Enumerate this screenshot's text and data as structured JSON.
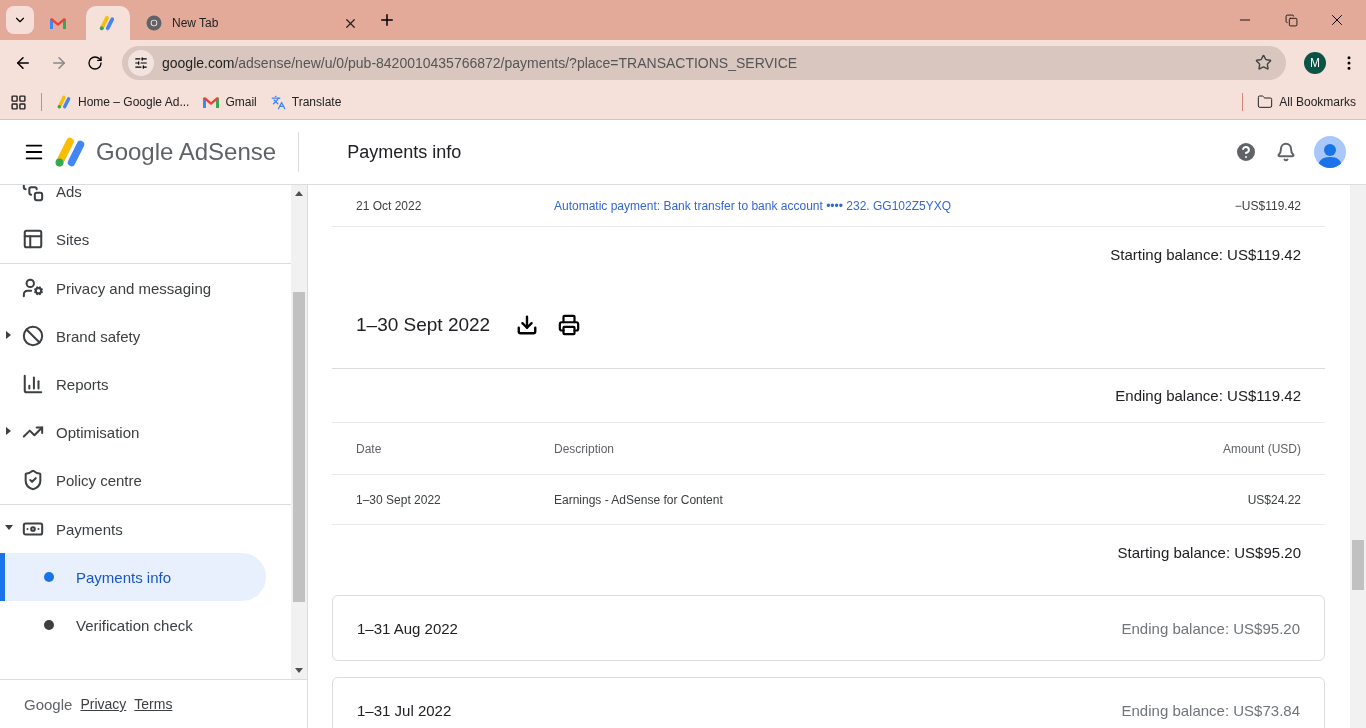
{
  "browser": {
    "tabs": [
      {
        "kind": "gmail",
        "selected": false
      },
      {
        "kind": "adsense",
        "selected": true
      },
      {
        "kind": "chrome",
        "title": "New Tab",
        "selected": false
      }
    ],
    "url_host": "google.com",
    "url_path": "/adsense/new/u/0/pub-8420010435766872/payments/?place=TRANSACTIONS_SERVICE",
    "profile": "M",
    "bookmarks": [
      {
        "kind": "adsense",
        "label": "Home – Google Ad..."
      },
      {
        "kind": "gmail",
        "label": "Gmail"
      },
      {
        "kind": "translate",
        "label": "Translate"
      }
    ],
    "all_bookmarks": "All Bookmarks"
  },
  "header": {
    "logo": "Google AdSense",
    "title": "Payments info"
  },
  "sidebar": {
    "groups": [
      [
        {
          "kind": "ads",
          "label": "Ads"
        },
        {
          "kind": "sites",
          "label": "Sites"
        }
      ],
      [
        {
          "kind": "privacy",
          "label": "Privacy and messaging"
        },
        {
          "kind": "brand",
          "label": "Brand safety",
          "expanded": false
        },
        {
          "kind": "reports",
          "label": "Reports"
        },
        {
          "kind": "optimisation",
          "label": "Optimisation",
          "expanded": false
        },
        {
          "kind": "policy",
          "label": "Policy centre"
        }
      ],
      [
        {
          "kind": "payments",
          "label": "Payments",
          "expanded": true,
          "children": [
            {
              "label": "Payments info",
              "selected": true
            },
            {
              "label": "Verification check",
              "selected": false
            }
          ]
        }
      ]
    ],
    "footer": {
      "brand": "Google",
      "links": [
        "Privacy",
        "Terms"
      ]
    }
  },
  "main": {
    "top_row": {
      "date": "21 Oct 2022",
      "description": "Automatic payment: Bank transfer to bank account •••• 232. GG102Z5YXQ",
      "amount": "−US$119.42"
    },
    "top_starting_balance": "Starting balance: US$119.42",
    "section": {
      "title": "1–30 Sept 2022",
      "ending_balance": "Ending balance: US$119.42",
      "columns": [
        "Date",
        "Description",
        "Amount (USD)"
      ],
      "rows": [
        [
          "1–30 Sept 2022",
          "Earnings - AdSense for Content",
          "US$24.22"
        ]
      ],
      "starting_balance": "Starting balance: US$95.20"
    },
    "cards": [
      {
        "title": "1–31 Aug 2022",
        "ending_balance": "Ending balance: US$95.20"
      },
      {
        "title": "1–31 Jul 2022",
        "ending_balance": "Ending balance: US$73.84"
      }
    ]
  }
}
